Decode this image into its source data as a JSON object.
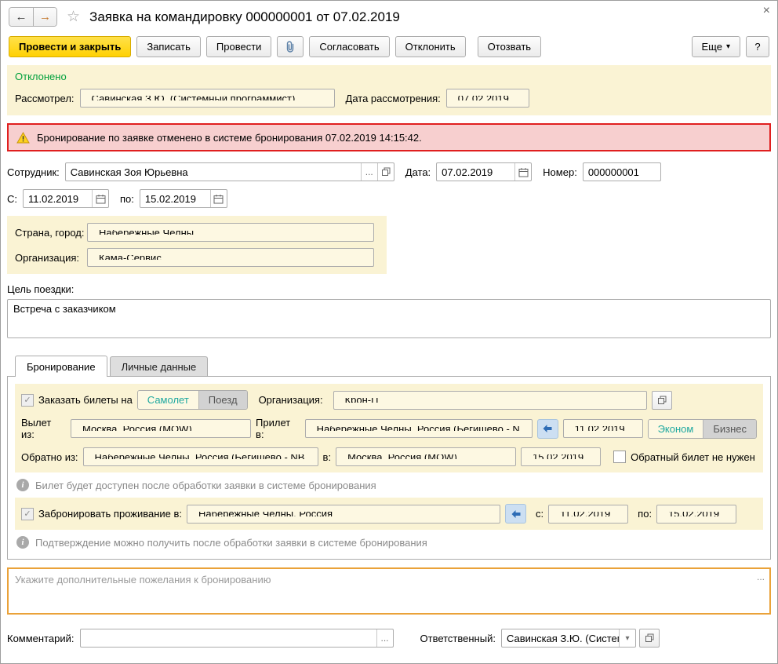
{
  "colors": {
    "primary_button": "#FFD400",
    "status_green": "#00A03C",
    "alert_border": "#E01F1F",
    "alert_bg": "#F7CFCF",
    "panel_cream": "#FAF3D4",
    "accent_teal": "#1FA8A0",
    "wishes_border": "#EAA239"
  },
  "icons": {
    "back": "←",
    "forward": "→",
    "favorite": "☆",
    "close": "×",
    "caret": "▾",
    "dots": "...",
    "info": "i",
    "check": "✓"
  },
  "header": {
    "title": "Заявка на командировку 000000001 от 07.02.2019"
  },
  "toolbar": {
    "post_and_close": "Провести и закрыть",
    "write": "Записать",
    "post": "Провести",
    "approve": "Согласовать",
    "decline": "Отклонить",
    "recall": "Отозвать",
    "more": "Еще",
    "help": "?"
  },
  "status": {
    "state": "Отклонено",
    "reviewer_label": "Рассмотрел:",
    "reviewer": "Савинская З.Ю. (Системный программист)",
    "date_label": "Дата рассмотрения:",
    "date": "07.02.2019"
  },
  "alert": {
    "text": "Бронирование по заявке отменено в системе бронирования 07.02.2019 14:15:42."
  },
  "main": {
    "employee_label": "Сотрудник:",
    "employee": "Савинская Зоя Юрьевна",
    "date_label": "Дата:",
    "date": "07.02.2019",
    "number_label": "Номер:",
    "number": "000000001",
    "period_from_label": "С:",
    "period_from": "11.02.2019",
    "period_to_label": "по:",
    "period_to": "15.02.2019",
    "country_city_label": "Страна, город:",
    "country_city": "Набережные Челны",
    "organization_label": "Организация:",
    "organization": "Кама-Сервис",
    "purpose_label": "Цель поездки:",
    "purpose": "Встреча с заказчиком"
  },
  "tabs": {
    "booking": "Бронирование",
    "personal": "Личные данные"
  },
  "booking": {
    "order_tickets_label": "Заказать билеты на",
    "transport_plane": "Самолет",
    "transport_train": "Поезд",
    "organization_label": "Организация:",
    "organization": "Крон-Ц",
    "depart_from_label": "Вылет из:",
    "depart_from": "Москва, Россия (MOW)",
    "arrive_to_label": "Прилет в:",
    "arrive_to": "Набережные Челны, Россия (Бегишево  - N",
    "depart_date": "11.02.2019",
    "class_economy": "Эконом",
    "class_business": "Бизнес",
    "return_from_label": "Обратно из:",
    "return_from": "Набережные Челны, Россия (Бегишево  - NB",
    "return_to_label": "в:",
    "return_to": "Москва, Россия (MOW)",
    "return_date": "15.02.2019",
    "no_return_ticket": "Обратный билет не нужен",
    "ticket_note": "Билет будет доступен после обработки заявки в системе бронирования",
    "hotel_label": "Забронировать проживание  в:",
    "hotel_city": "Набережные Челны, Россия",
    "hotel_from_label": "с:",
    "hotel_from": "11.02.2019",
    "hotel_to_label": "по:",
    "hotel_to": "15.02.2019",
    "hotel_note": "Подтверждение можно получить после обработки заявки в системе бронирования"
  },
  "wishes": {
    "placeholder": "Укажите дополнительные пожелания к бронированию"
  },
  "footer": {
    "comment_label": "Комментарий:",
    "responsible_label": "Ответственный:",
    "responsible": "Савинская З.Ю. (Системн"
  }
}
